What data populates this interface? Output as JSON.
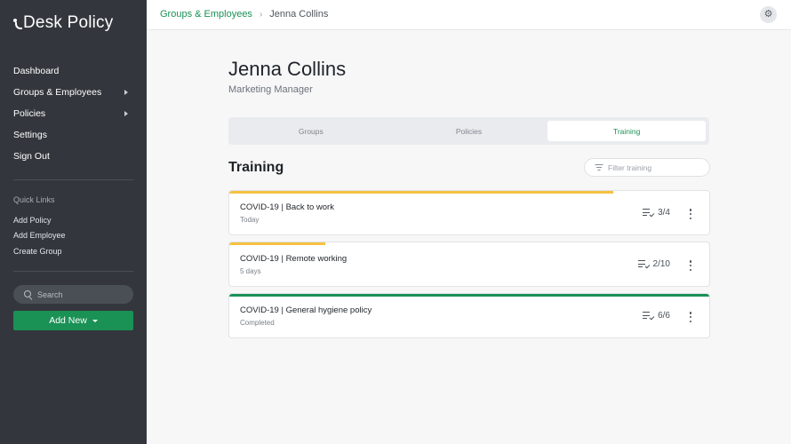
{
  "brand": {
    "name": "Desk Policy"
  },
  "sidebar": {
    "nav": [
      {
        "label": "Dashboard",
        "has_children": false
      },
      {
        "label": "Groups & Employees",
        "has_children": true
      },
      {
        "label": "Policies",
        "has_children": true
      },
      {
        "label": "Settings",
        "has_children": false
      },
      {
        "label": "Sign Out",
        "has_children": false
      }
    ],
    "quick_links": {
      "title": "Quick Links",
      "items": [
        "Add Policy",
        "Add Employee",
        "Create Group"
      ]
    },
    "search": {
      "placeholder": "Search",
      "value": ""
    },
    "add_new_label": "Add New"
  },
  "breadcrumb": {
    "parent": "Groups & Employees",
    "separator": "›",
    "current": "Jenna Collins"
  },
  "profile": {
    "name": "Jenna Collins",
    "role": "Marketing Manager"
  },
  "tabs": [
    {
      "label": "Groups",
      "active": false
    },
    {
      "label": "Policies",
      "active": false
    },
    {
      "label": "Training",
      "active": true
    }
  ],
  "training": {
    "title": "Training",
    "filter_placeholder": "Filter training",
    "items": [
      {
        "title": "COVID-19 | Back to work",
        "status": "Today",
        "count": "3/4",
        "progress": 0.8,
        "color": "#f5c242"
      },
      {
        "title": "COVID-19 | Remote working",
        "status": "5 days",
        "count": "2/10",
        "progress": 0.2,
        "color": "#f5c242"
      },
      {
        "title": "COVID-19 | General hygiene policy",
        "status": "Completed",
        "count": "6/6",
        "progress": 1.0,
        "color": "#1a9155"
      }
    ]
  },
  "colors": {
    "accent": "#1a9155",
    "sidebar_bg": "#33373d",
    "in_progress": "#f5c242"
  }
}
